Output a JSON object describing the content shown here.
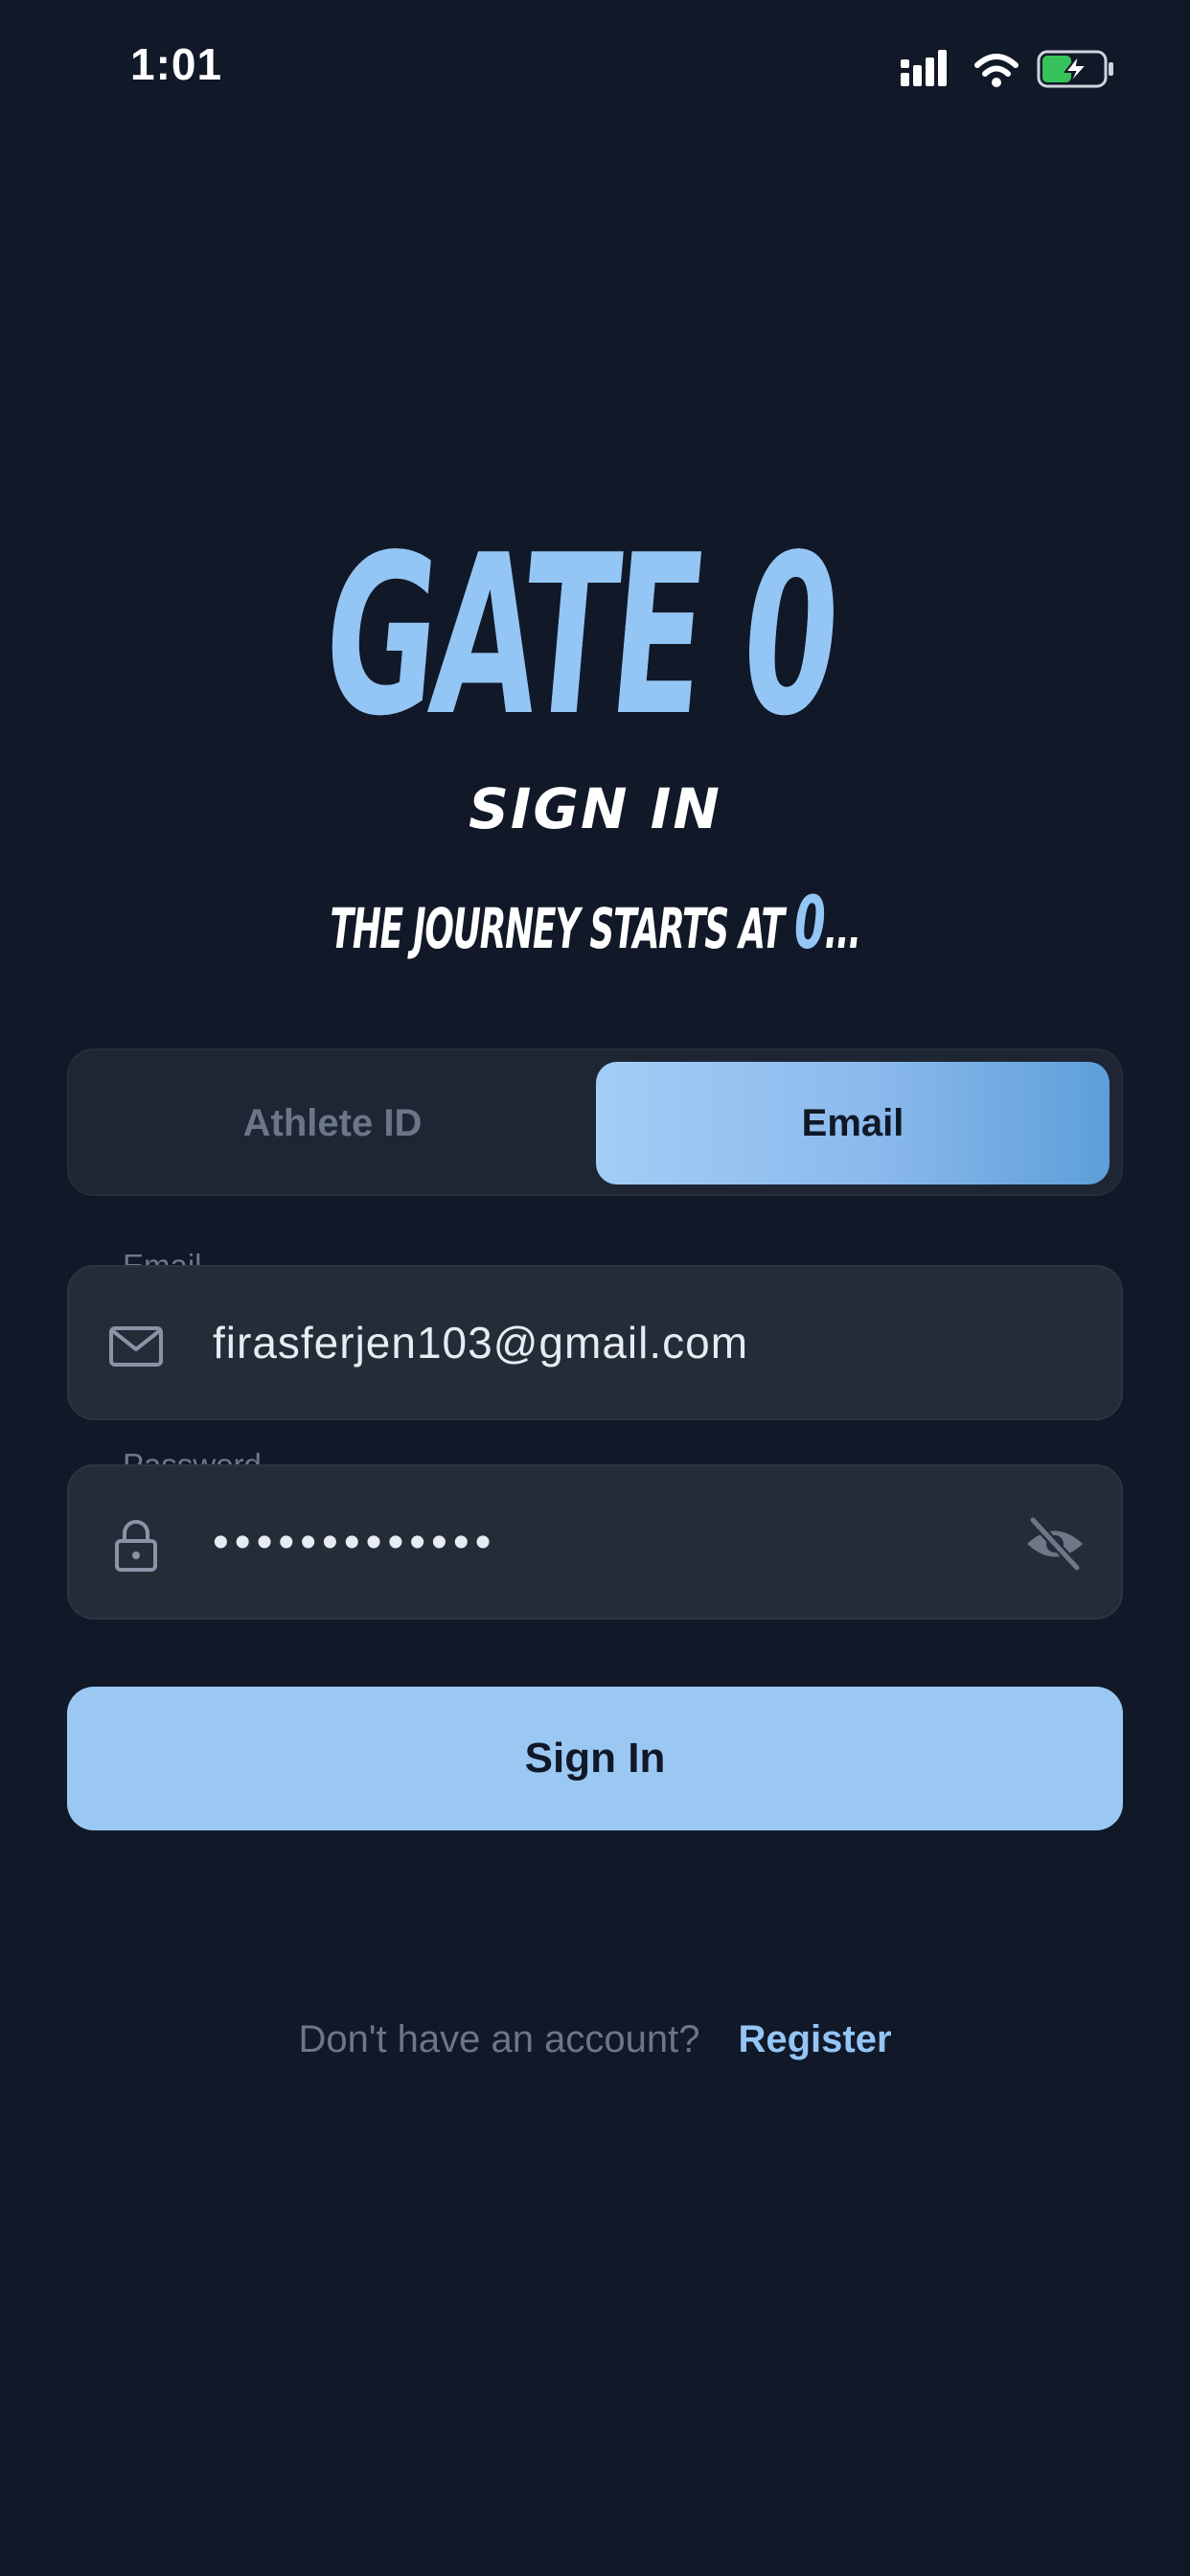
{
  "status_bar": {
    "time": "1:01"
  },
  "brand": {
    "logo": "GATE 0",
    "heading": "SIGN IN",
    "tagline_prefix": "THE JOURNEY STARTS AT ",
    "tagline_accent": "0",
    "tagline_suffix": "..."
  },
  "login_mode": {
    "options": [
      "Athlete ID",
      "Email"
    ],
    "selected": "Email"
  },
  "email_field": {
    "label": "Email",
    "value": "firasferjen103@gmail.com",
    "icon": "mail-icon"
  },
  "password_field": {
    "label": "Password",
    "value": "•••••••••••••",
    "icon": "lock-icon",
    "toggle_icon": "eye-off-icon"
  },
  "actions": {
    "sign_in_label": "Sign In"
  },
  "footer": {
    "prompt": "Don't have an account?",
    "link": "Register"
  },
  "colors": {
    "background": "#111827",
    "accent": "#93c5f5",
    "field_bg": "#242c38",
    "muted_text": "#6b7688"
  }
}
